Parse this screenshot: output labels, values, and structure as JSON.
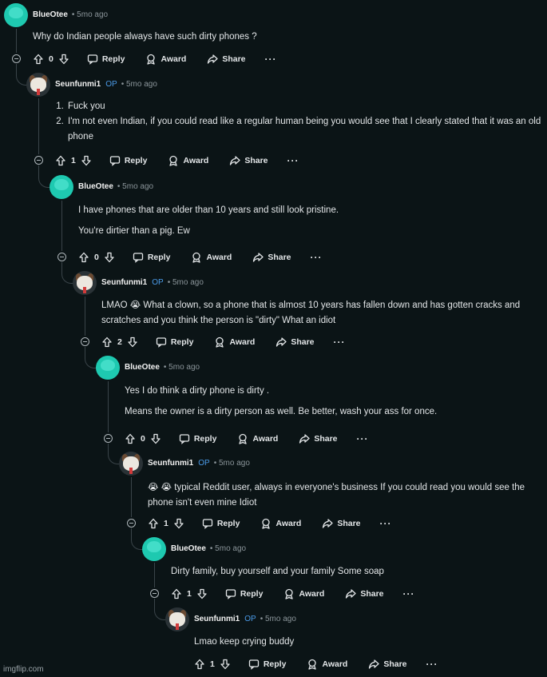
{
  "thread": {
    "comments": [
      {
        "author": "BlueOtee",
        "op_badge": "",
        "time": "• 5mo ago",
        "avatar": "teal-snoo-avatar",
        "lines": [
          "Why do Indian people always have such dirty phones ?"
        ],
        "votes": "0",
        "reply": "Reply",
        "award": "Award",
        "share": "Share",
        "more": "···"
      },
      {
        "author": "Seunfunmi1",
        "op_badge": "OP",
        "time": "• 5mo ago",
        "avatar": "dog-avatar",
        "list": [
          "Fuck you",
          "I'm not even Indian, if you could read like a regular human being you would see that I clearly stated that it was an old phone"
        ],
        "votes": "1",
        "reply": "Reply",
        "award": "Award",
        "share": "Share",
        "more": "···"
      },
      {
        "author": "BlueOtee",
        "op_badge": "",
        "time": "• 5mo ago",
        "avatar": "teal-snoo-avatar",
        "lines": [
          "I have phones that are older than 10 years and still look pristine.",
          "You're dirtier than a pig. Ew"
        ],
        "votes": "0",
        "reply": "Reply",
        "award": "Award",
        "share": "Share",
        "more": "···"
      },
      {
        "author": "Seunfunmi1",
        "op_badge": "OP",
        "time": "• 5mo ago",
        "avatar": "dog-avatar",
        "lines": [
          "LMAO 😭 What a clown, so a phone that is almost 10 years has fallen down and has gotten cracks and scratches and you think the person is \"dirty\" What an idiot"
        ],
        "votes": "2",
        "reply": "Reply",
        "award": "Award",
        "share": "Share",
        "more": "···"
      },
      {
        "author": "BlueOtee",
        "op_badge": "",
        "time": "• 5mo ago",
        "avatar": "teal-snoo-avatar",
        "lines": [
          "Yes I do think a dirty phone is dirty .",
          "Means the owner is a dirty person as well. Be better, wash your ass for once."
        ],
        "votes": "0",
        "reply": "Reply",
        "award": "Award",
        "share": "Share",
        "more": "···"
      },
      {
        "author": "Seunfunmi1",
        "op_badge": "OP",
        "time": "• 5mo ago",
        "avatar": "dog-avatar",
        "lines": [
          "😭 😭 typical Reddit user, always in everyone's business If you could read you would see the phone isn't even mine Idiot"
        ],
        "votes": "1",
        "reply": "Reply",
        "award": "Award",
        "share": "Share",
        "more": "···"
      },
      {
        "author": "BlueOtee",
        "op_badge": "",
        "time": "• 5mo ago",
        "avatar": "teal-snoo-avatar",
        "lines": [
          "Dirty family, buy yourself and your family Some soap"
        ],
        "votes": "1",
        "reply": "Reply",
        "award": "Award",
        "share": "Share",
        "more": "···"
      },
      {
        "author": "Seunfunmi1",
        "op_badge": "OP",
        "time": "• 5mo ago",
        "avatar": "dog-avatar",
        "lines": [
          "Lmao keep crying buddy"
        ],
        "votes": "1",
        "reply": "Reply",
        "award": "Award",
        "share": "Share",
        "more": "···"
      }
    ]
  },
  "watermark": "imgflip.com",
  "colors": {
    "background": "#0b1416",
    "op_badge": "#4b9be8",
    "teal_avatar": "#1ec9b0",
    "thread_line": "#3a4449"
  }
}
